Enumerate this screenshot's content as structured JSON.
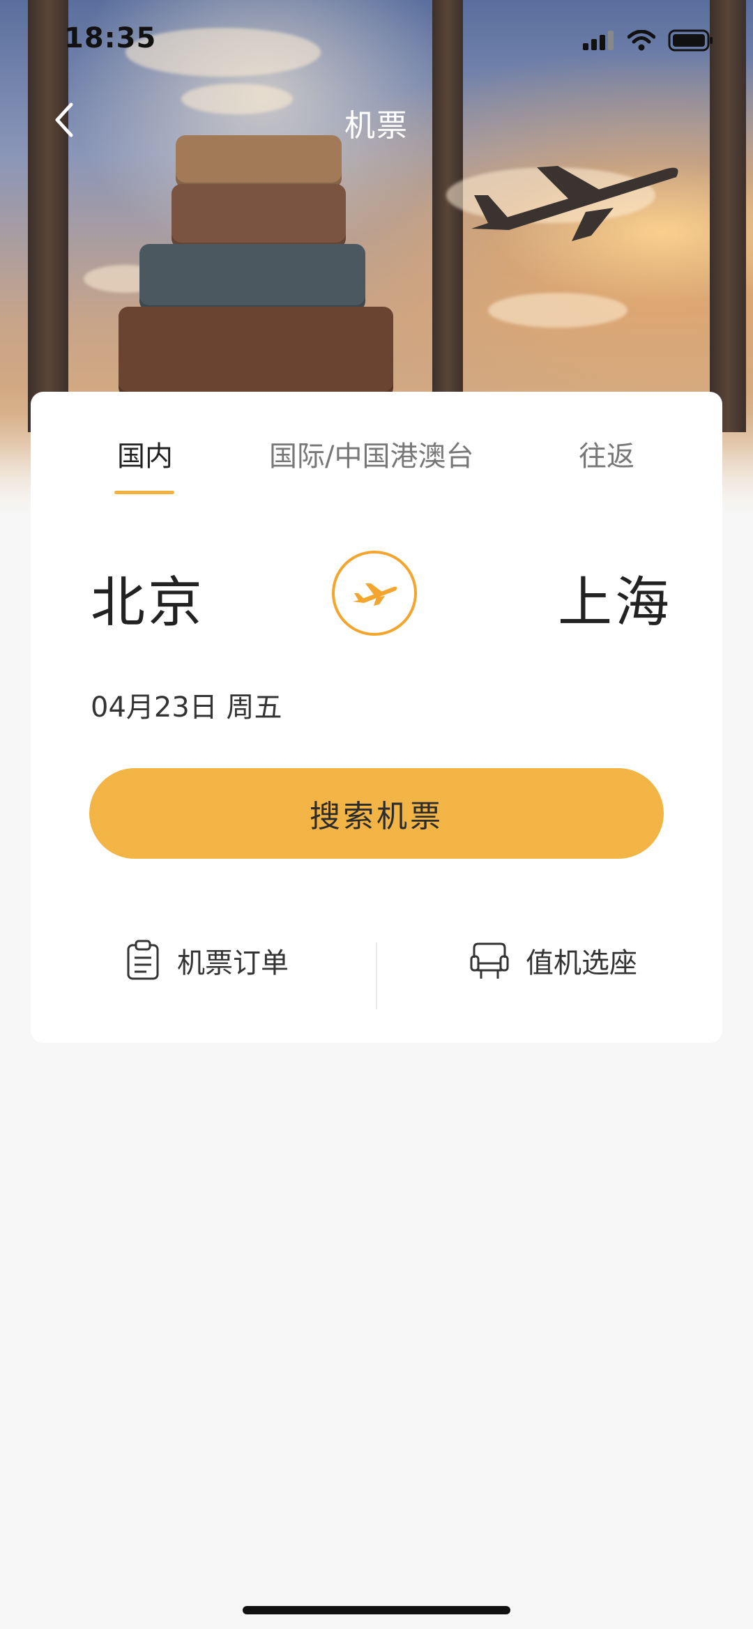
{
  "status_bar": {
    "time": "18:35",
    "icons": [
      "signal-icon",
      "wifi-icon",
      "battery-icon"
    ]
  },
  "nav": {
    "title": "机票",
    "back_icon": "chevron-left-icon"
  },
  "tabs": [
    {
      "label": "国内",
      "active": true
    },
    {
      "label": "国际/中国港澳台",
      "active": false
    },
    {
      "label": "往返",
      "active": false
    }
  ],
  "route": {
    "from": "北京",
    "to": "上海",
    "swap_icon": "plane-icon"
  },
  "date": "04月23日 周五",
  "search_button": "搜索机票",
  "actions": [
    {
      "label": "机票订单",
      "icon": "clipboard-icon"
    },
    {
      "label": "值机选座",
      "icon": "seat-icon"
    }
  ],
  "colors": {
    "accent": "#f2b444",
    "plane_icon": "#f3a52d",
    "background": "#f7f7f7"
  }
}
